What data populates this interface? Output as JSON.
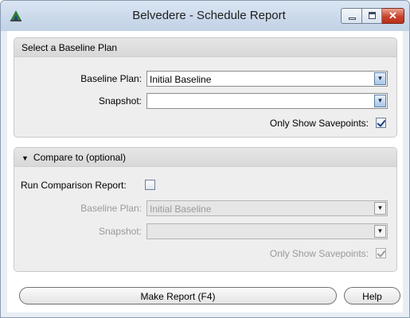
{
  "window": {
    "title": "Belvedere - Schedule Report",
    "app_icon": "belvedere-app-icon",
    "controls": {
      "minimize_icon": "minimize-icon",
      "maximize_icon": "maximize-icon",
      "close_icon": "close-icon",
      "close_glyph": "✕"
    }
  },
  "baseline_section": {
    "header": "Select a Baseline Plan",
    "baseline_plan_label": "Baseline Plan:",
    "baseline_plan_value": "Initial Baseline",
    "snapshot_label": "Snapshot:",
    "snapshot_value": "",
    "only_savepoints_label": "Only Show Savepoints:",
    "only_savepoints_checked": true
  },
  "compare_section": {
    "header": "Compare to (optional)",
    "collapse_icon": "triangle-down-icon",
    "run_comparison_label": "Run Comparison Report:",
    "run_comparison_checked": false,
    "baseline_plan_label": "Baseline Plan:",
    "baseline_plan_value": "Initial Baseline",
    "snapshot_label": "Snapshot:",
    "snapshot_value": "",
    "only_savepoints_label": "Only Show Savepoints:",
    "only_savepoints_checked": true
  },
  "actions": {
    "make_report_label": "Make Report (F4)",
    "help_label": "Help"
  },
  "colors": {
    "accent": "#1f3f7a",
    "close_button": "#c9432b",
    "panel_bg": "#eeeeee"
  }
}
